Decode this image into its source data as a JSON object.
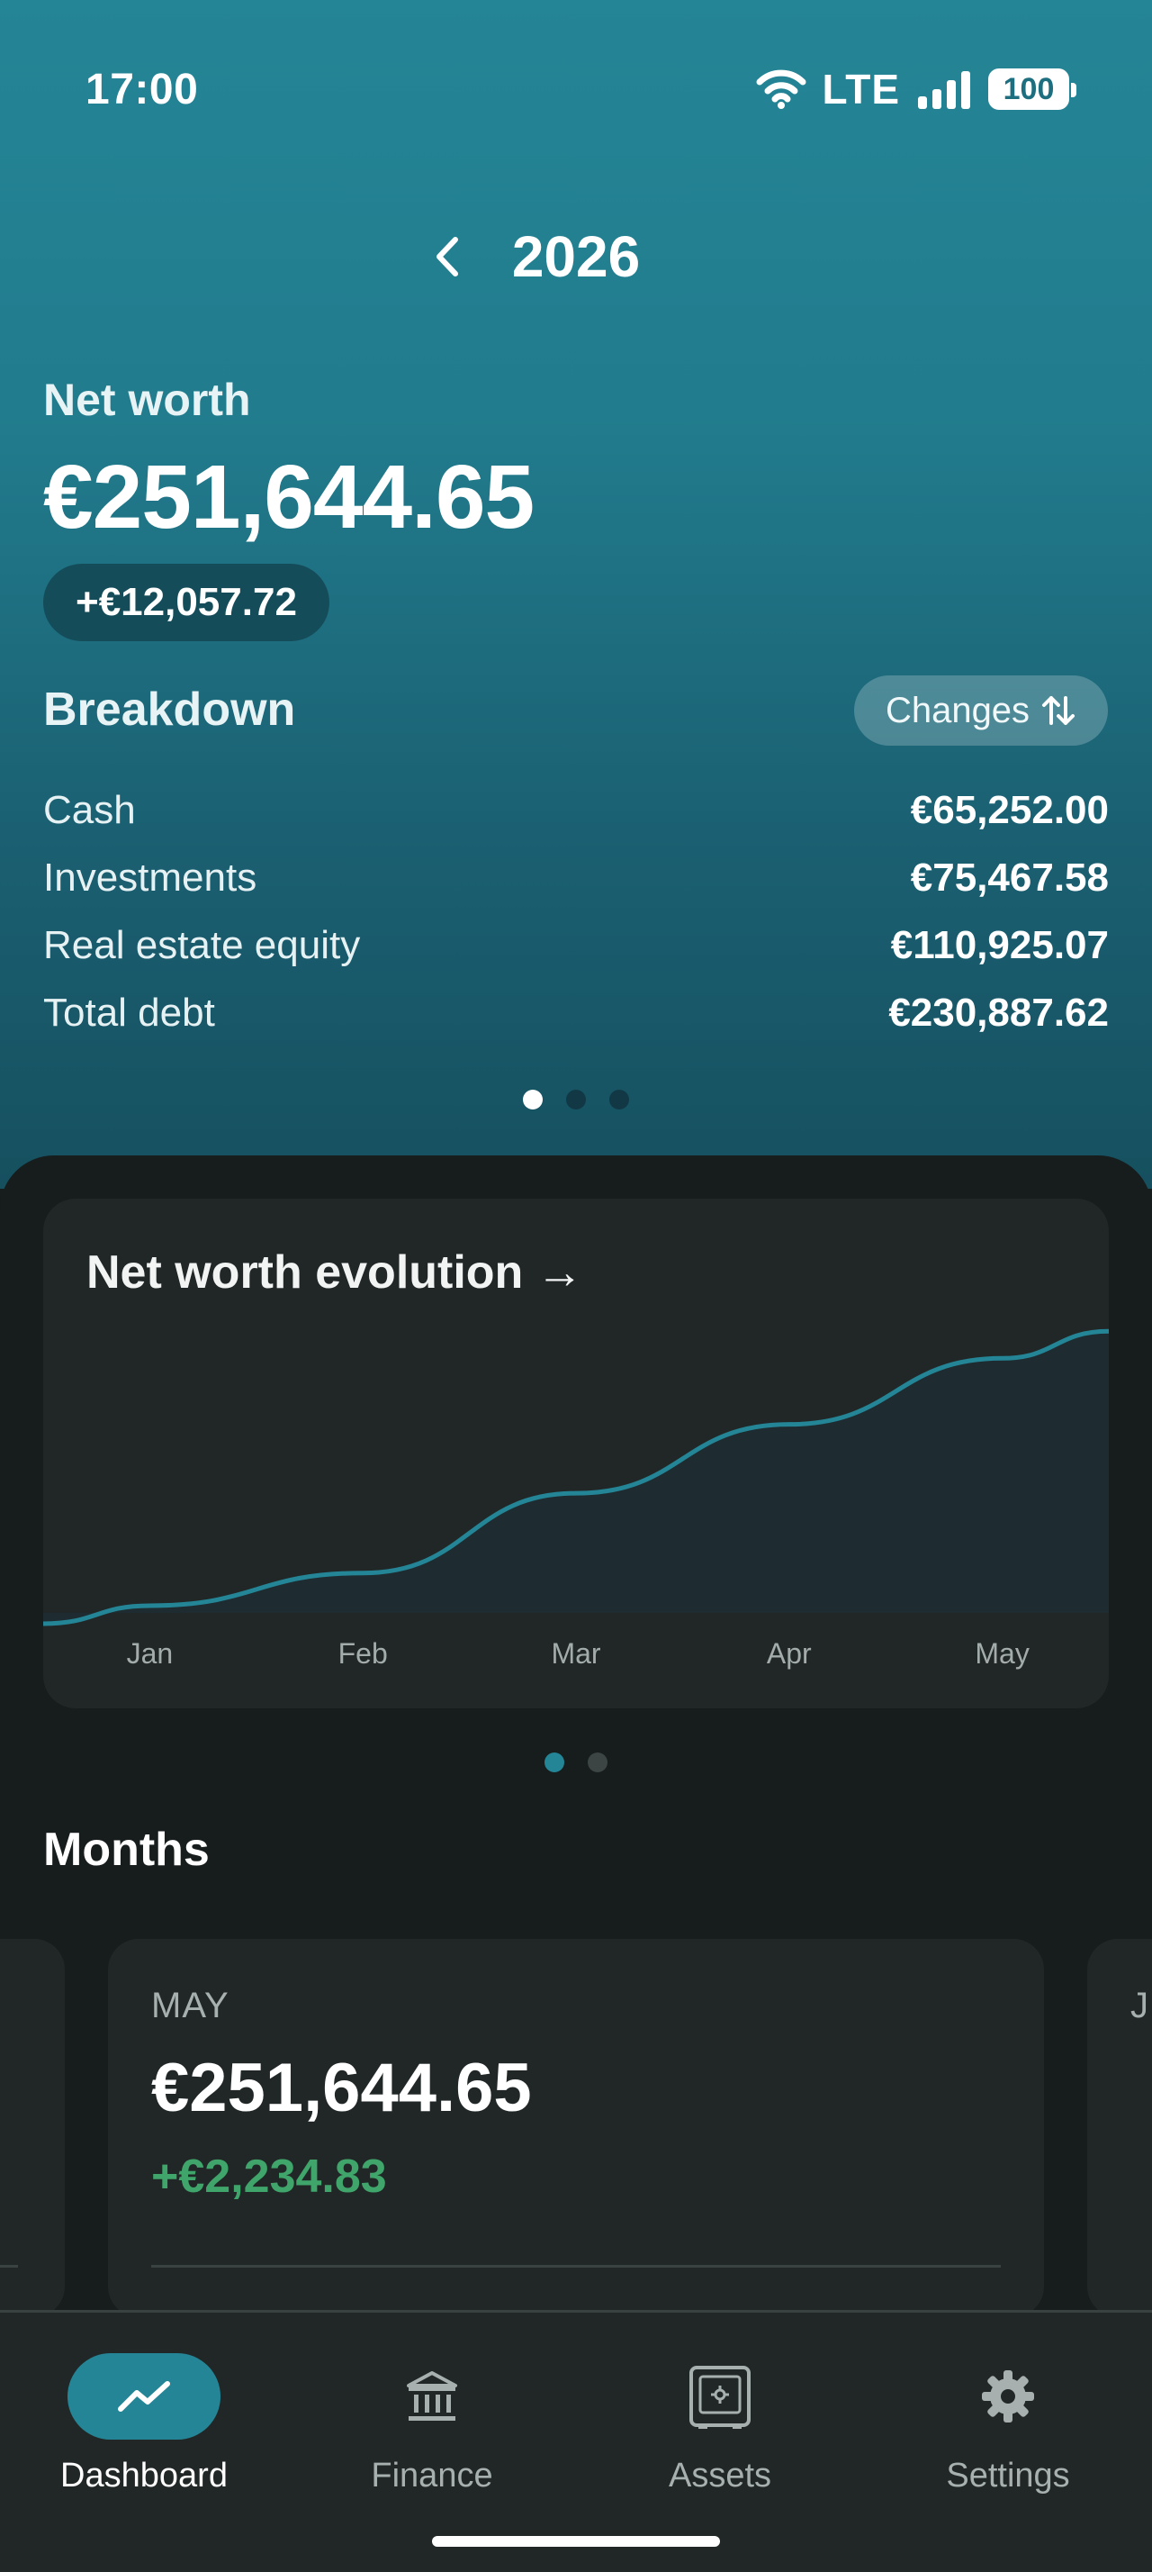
{
  "status_bar": {
    "time": "17:00",
    "network": "LTE",
    "battery": "100"
  },
  "header": {
    "year": "2026"
  },
  "net_worth": {
    "label": "Net worth",
    "value": "€251,644.65",
    "change": "+€12,057.72"
  },
  "breakdown": {
    "title": "Breakdown",
    "changes_label": "Changes",
    "items": [
      {
        "label": "Cash",
        "value": "€65,252.00"
      },
      {
        "label": "Investments",
        "value": "€75,467.58"
      },
      {
        "label": "Real estate equity",
        "value": "€110,925.07"
      },
      {
        "label": "Total debt",
        "value": "€230,887.62"
      }
    ]
  },
  "chart": {
    "title": "Net worth evolution →",
    "chart_data": {
      "type": "area",
      "categories": [
        "Jan",
        "Feb",
        "Mar",
        "Apr",
        "May"
      ],
      "values": [
        238000,
        239800,
        244200,
        248000,
        251644.65
      ],
      "line_color": "#248596"
    }
  },
  "months": {
    "title": "Months",
    "cards": [
      {
        "month": "MAY",
        "value": "€251,644.65",
        "change": "+€2,234.83"
      },
      {
        "month": "J"
      }
    ]
  },
  "nav": {
    "items": [
      {
        "label": "Dashboard",
        "icon": "trending-up-icon",
        "active": true
      },
      {
        "label": "Finance",
        "icon": "bank-icon",
        "active": false
      },
      {
        "label": "Assets",
        "icon": "safe-icon",
        "active": false
      },
      {
        "label": "Settings",
        "icon": "gear-icon",
        "active": false
      }
    ]
  }
}
